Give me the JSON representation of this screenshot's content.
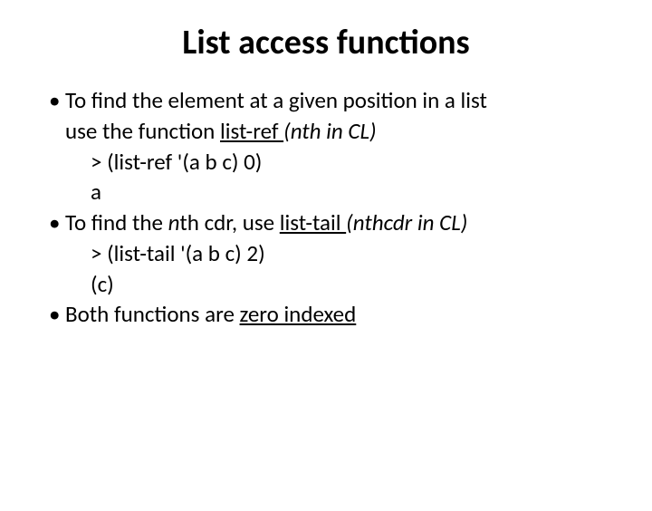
{
  "title": "List access functions",
  "b1_l1": "To find the element at a given position in a list",
  "b1_l2_a": "use the function ",
  "b1_l2_u": "list-ref ",
  "b1_l2_i": "(nth in CL)",
  "b1_code": "> (list-ref  '(a  b  c) 0)",
  "b1_result": "a",
  "b2_a": "To find the ",
  "b2_i1": "n",
  "b2_b": "th cdr,  use ",
  "b2_u": "list-tail ",
  "b2_i2": "(nthcdr in CL)",
  "b2_code": "> (list-tail  '(a  b  c) 2)",
  "b2_result": "(c)",
  "b3_a": "Both functions are ",
  "b3_u": "zero indexed"
}
